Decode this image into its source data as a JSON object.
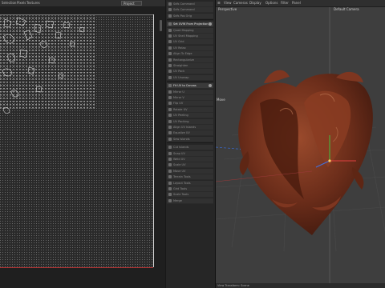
{
  "uv_editor": {
    "menu": [
      "Selection",
      "Pixels",
      "Textures"
    ],
    "project_select": "Project"
  },
  "commands": {
    "items": [
      {
        "label": "Sdfs Command"
      },
      {
        "label": "Sdfs Command"
      },
      {
        "label": "Sdfs Pos Orig"
      },
      {
        "label": "Set UVW From Projection",
        "active": true
      },
      {
        "label": "Quad Mapping"
      },
      {
        "label": "UV Shell Mapping"
      },
      {
        "label": "UV Grid"
      },
      {
        "label": "UV Relax"
      },
      {
        "label": "Align To Edge"
      },
      {
        "label": "Rectangularize"
      },
      {
        "label": "Straighten"
      },
      {
        "label": "UV Pack"
      },
      {
        "label": "UV Unwrap"
      },
      {
        "label": "Fit UV to Canvas",
        "active": true
      },
      {
        "label": "Mirror U"
      },
      {
        "label": "Mirror V"
      },
      {
        "label": "Flip UV"
      },
      {
        "label": "Rotate UV"
      },
      {
        "label": "UV Peeling"
      },
      {
        "label": "UV Packing"
      },
      {
        "label": "Align UV Islands"
      },
      {
        "label": "Equalize UV"
      },
      {
        "label": "Sew Islands"
      },
      {
        "label": "Cut Islands"
      },
      {
        "label": "Snap UV"
      },
      {
        "label": "Weld UV"
      },
      {
        "label": "Scale UV"
      },
      {
        "label": "Move UV"
      },
      {
        "label": "Terrain Tools"
      },
      {
        "label": "Layout Tools"
      },
      {
        "label": "Grid Tools"
      },
      {
        "label": "Scale Tools"
      },
      {
        "label": "Merge"
      }
    ]
  },
  "viewport": {
    "menu": [
      "View",
      "Cameras",
      "Display",
      "Options",
      "Filter",
      "Panel"
    ],
    "label": "Perspective",
    "camera": "Default Camera",
    "mode_label": "Move",
    "status": "View Transform: Scene",
    "object_color": "#6b2d1a"
  }
}
